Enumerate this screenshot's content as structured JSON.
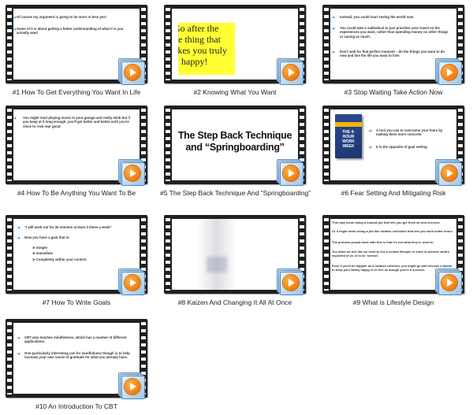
{
  "videos": [
    {
      "caption": "#1 How To Get Everything You Want In Life",
      "bullets": [
        "Of course my argument is going to be more or less yes!",
        "Some of it is about getting a better understanding of what it is you actually want"
      ]
    },
    {
      "caption": "#2 Knowing What You Want",
      "lines": [
        "Go after the",
        "ne thing that",
        "akes you truly",
        "happy!"
      ]
    },
    {
      "caption": "#3 Stop Waiting Take Action Now",
      "bullets": [
        "Instead, you could start seeing the world now.",
        "You could take a sabbatical or just prioritize your travel on the experiences you want, rather than spending money on other things or saving as much.",
        "Don't wait for that perfect moment – do the things you want to do now and live the life you want to live!"
      ]
    },
    {
      "caption": "#4 How To Be Anything You Want To Be",
      "bullets": [
        "You might start playing music in your garage and really stink but if you keep at it long enough, you'll get better and better until you're close to rock-star good."
      ]
    },
    {
      "caption": "#5 The Step Back Technique And “Springboarding”",
      "title": "The Step Back Technique and “Springboarding”"
    },
    {
      "caption": "#6 Fear Setting And Mitigating Risk",
      "book": "THE 4-HOUR WORK WEEK",
      "bullets": [
        "A tool you use to overcome your fears by making them more concrete.",
        "It is the opposite of goal setting"
      ]
    },
    {
      "caption": "#7 How To Write Goals",
      "bullets": [
        "“I will work out for 30 minutes at least 3 times a week”",
        "Now you have a goal that is:"
      ],
      "sub": [
        "Simple",
        "Immediate",
        "Completely within your control."
      ]
    },
    {
      "caption": "#8 Kaizen And Changing It All At Once"
    },
    {
      "caption": "#9 What is Lifestyle Design",
      "paras": [
        "This may mean doing a manual job that lets you get fresh air and exercise.",
        "Or it might mean doing a job like rubbish collection that lets you work better hours.",
        "The problem people have with this is that it's not what they're used to.",
        "Too often we feel like we need to live a certain lifestyle in order to achieve what's expected of us or to be 'normal'.",
        "Even if you'd be happier as a rubbish collector, you might go and become a doctor to keep your family happy or to feel as though you're a success."
      ]
    },
    {
      "caption": "#10 An Introduction To CBT",
      "bullets": [
        "CBT also teaches mindfulness, which has a number of different applications.",
        "One particularly interesting use for mindfulness though is to help increase your own sense of gratitude for what you already have."
      ]
    }
  ]
}
